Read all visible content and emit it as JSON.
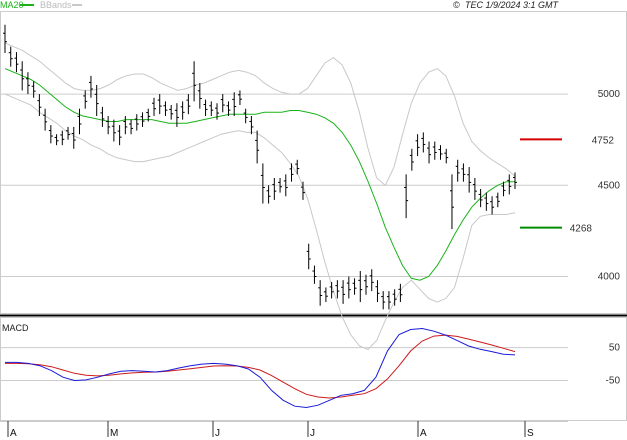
{
  "header": {
    "timestamp": "TEC 1/9/2024 3:1 GMT",
    "copyright_symbol": "©"
  },
  "legend": {
    "ma_label": "MA20",
    "bb_label": "BBands"
  },
  "colors": {
    "price": "#000000",
    "ma": "#19b219",
    "bbands": "#c8c8c8",
    "macd_line": "#1a1ad9",
    "signal_line": "#cc1a1a",
    "resistance": "#d40000",
    "support": "#008c00",
    "grid": "#cccccc"
  },
  "levels": {
    "resistance": {
      "value": 4752,
      "label": "4752"
    },
    "support": {
      "value": 4268,
      "label": "4268"
    }
  },
  "chart_data": [
    {
      "type": "line",
      "subtype": "ohlc-bars",
      "title": "",
      "y_ticks": [
        {
          "value": 4000,
          "label": "4000"
        },
        {
          "value": 4500,
          "label": "4500"
        },
        {
          "value": 5000,
          "label": "5000"
        }
      ],
      "ylim": [
        3800,
        5450
      ],
      "x_months": [
        "A",
        "M",
        "J",
        "J",
        "A",
        "S"
      ],
      "grid": true,
      "price_bars": [
        [
          5225,
          5380
        ],
        [
          5150,
          5260
        ],
        [
          5120,
          5230
        ],
        [
          5020,
          5180
        ],
        [
          5000,
          5120
        ],
        [
          4980,
          5070
        ],
        [
          4880,
          5000
        ],
        [
          4800,
          4920
        ],
        [
          4730,
          4830
        ],
        [
          4720,
          4780
        ],
        [
          4720,
          4800
        ],
        [
          4750,
          4820
        ],
        [
          4700,
          4820
        ],
        [
          4780,
          4920
        ],
        [
          4920,
          5020
        ],
        [
          4980,
          5100
        ],
        [
          4880,
          5050
        ],
        [
          4820,
          4930
        ],
        [
          4780,
          4880
        ],
        [
          4740,
          4860
        ],
        [
          4720,
          4830
        ],
        [
          4780,
          4880
        ],
        [
          4780,
          4860
        ],
        [
          4800,
          4890
        ],
        [
          4820,
          4900
        ],
        [
          4850,
          4920
        ],
        [
          4880,
          4980
        ],
        [
          4890,
          5000
        ],
        [
          4880,
          4960
        ],
        [
          4860,
          4940
        ],
        [
          4820,
          4950
        ],
        [
          4860,
          4960
        ],
        [
          4890,
          5000
        ],
        [
          4960,
          5180
        ],
        [
          4920,
          5060
        ],
        [
          4880,
          4970
        ],
        [
          4880,
          4960
        ],
        [
          4860,
          4950
        ],
        [
          4900,
          5000
        ],
        [
          4880,
          4960
        ],
        [
          4880,
          5010
        ],
        [
          4940,
          5020
        ],
        [
          4840,
          4920
        ],
        [
          4780,
          4880
        ],
        [
          4620,
          4800
        ],
        [
          4400,
          4620
        ],
        [
          4400,
          4500
        ],
        [
          4420,
          4540
        ],
        [
          4460,
          4540
        ],
        [
          4440,
          4560
        ],
        [
          4520,
          4620
        ],
        [
          4560,
          4640
        ],
        [
          4420,
          4520
        ],
        [
          4040,
          4180
        ],
        [
          3960,
          4060
        ],
        [
          3840,
          3980
        ],
        [
          3860,
          3940
        ],
        [
          3880,
          3970
        ],
        [
          3880,
          3980
        ],
        [
          3850,
          3980
        ],
        [
          3880,
          4000
        ],
        [
          3900,
          3990
        ],
        [
          3860,
          4030
        ],
        [
          3900,
          4010
        ],
        [
          3920,
          4040
        ],
        [
          3860,
          3980
        ],
        [
          3820,
          3920
        ],
        [
          3820,
          3920
        ],
        [
          3840,
          3930
        ],
        [
          3860,
          3960
        ],
        [
          4320,
          4560
        ],
        [
          4580,
          4700
        ],
        [
          4660,
          4780
        ],
        [
          4680,
          4790
        ],
        [
          4620,
          4740
        ],
        [
          4640,
          4740
        ],
        [
          4640,
          4720
        ],
        [
          4620,
          4700
        ],
        [
          4260,
          4560
        ],
        [
          4520,
          4640
        ],
        [
          4520,
          4620
        ],
        [
          4460,
          4600
        ],
        [
          4420,
          4540
        ],
        [
          4380,
          4480
        ],
        [
          4360,
          4460
        ],
        [
          4340,
          4440
        ],
        [
          4380,
          4460
        ],
        [
          4440,
          4520
        ],
        [
          4450,
          4560
        ],
        [
          4480,
          4570
        ]
      ],
      "ma20": [
        5140,
        5120,
        5100,
        5080,
        5050,
        5010,
        4970,
        4930,
        4900,
        4880,
        4870,
        4860,
        4850,
        4850,
        4860,
        4860,
        4860,
        4860,
        4850,
        4840,
        4840,
        4840,
        4850,
        4860,
        4870,
        4880,
        4890,
        4890,
        4890,
        4890,
        4900,
        4900,
        4900,
        4910,
        4910,
        4900,
        4890,
        4870,
        4840,
        4790,
        4720,
        4630,
        4520,
        4400,
        4270,
        4160,
        4060,
        3990,
        3980,
        4000,
        4060,
        4140,
        4230,
        4310,
        4380,
        4430,
        4470,
        4500,
        4520,
        4520
      ],
      "bb_upper": [
        5280,
        5260,
        5240,
        5210,
        5180,
        5140,
        5100,
        5060,
        5030,
        5020,
        5020,
        5030,
        5050,
        5080,
        5100,
        5110,
        5110,
        5090,
        5060,
        5040,
        5020,
        5030,
        5050,
        5060,
        5080,
        5100,
        5120,
        5130,
        5120,
        5100,
        5060,
        5030,
        5010,
        5000,
        5000,
        5030,
        5100,
        5170,
        5200,
        5160,
        5060,
        4900,
        4700,
        4540,
        4500,
        4600,
        4780,
        4950,
        5060,
        5120,
        5140,
        5100,
        4990,
        4840,
        4740,
        4690,
        4650,
        4620,
        4590,
        4550
      ],
      "bb_lower": [
        5000,
        4980,
        4960,
        4940,
        4900,
        4870,
        4840,
        4800,
        4770,
        4750,
        4720,
        4700,
        4670,
        4650,
        4640,
        4630,
        4630,
        4640,
        4650,
        4660,
        4680,
        4700,
        4720,
        4740,
        4760,
        4780,
        4790,
        4800,
        4790,
        4790,
        4760,
        4720,
        4680,
        4620,
        4550,
        4430,
        4260,
        4080,
        3920,
        3780,
        3680,
        3620,
        3600,
        3650,
        3760,
        3860,
        3940,
        3980,
        3930,
        3880,
        3860,
        3880,
        3940,
        4100,
        4280,
        4330,
        4340,
        4340,
        4340,
        4350
      ]
    },
    {
      "type": "line",
      "title": "MACD",
      "y_ticks": [
        {
          "value": 50,
          "label": "50"
        },
        {
          "value": -50,
          "label": "-50"
        }
      ],
      "ylim": [
        -170,
        140
      ],
      "series": [
        {
          "name": "",
          "values": [
            5,
            5,
            2,
            -5,
            -20,
            -40,
            -50,
            -48,
            -40,
            -30,
            -22,
            -20,
            -22,
            -24,
            -20,
            -12,
            -5,
            0,
            2,
            0,
            -5,
            -15,
            -40,
            -80,
            -110,
            -128,
            -132,
            -125,
            -110,
            -95,
            -90,
            -80,
            -40,
            40,
            90,
            105,
            108,
            100,
            88,
            72,
            55,
            45,
            38,
            30,
            28
          ]
        },
        {
          "name": "",
          "values": [
            2,
            2,
            1,
            -2,
            -8,
            -18,
            -28,
            -34,
            -36,
            -34,
            -30,
            -27,
            -25,
            -24,
            -22,
            -18,
            -14,
            -10,
            -6,
            -5,
            -6,
            -10,
            -18,
            -35,
            -55,
            -75,
            -92,
            -100,
            -103,
            -100,
            -95,
            -90,
            -75,
            -45,
            -5,
            40,
            70,
            85,
            88,
            84,
            76,
            67,
            58,
            48,
            38
          ]
        }
      ]
    }
  ]
}
